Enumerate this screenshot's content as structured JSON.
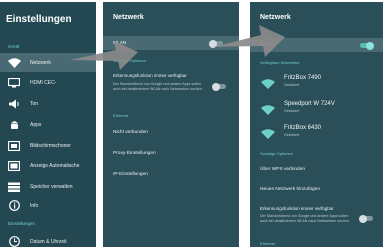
{
  "panel_settings": {
    "title": "Einstellungen",
    "section_device": "Gerät",
    "items": [
      {
        "label": "Netzwerk",
        "icon": "wifi-icon"
      },
      {
        "label": "HDMI CEC-",
        "icon": "hdmi-icon"
      },
      {
        "label": "Ton",
        "icon": "speaker-icon"
      },
      {
        "label": "Apps",
        "icon": "android-icon"
      },
      {
        "label": "Bildschirmschoner",
        "icon": "screensaver-icon"
      },
      {
        "label": "Anzeige Automatische",
        "icon": "display-icon"
      },
      {
        "label": "Speicher verwalten",
        "icon": "storage-icon"
      },
      {
        "label": "Info",
        "icon": "info-icon"
      }
    ],
    "section_settings": "Einstellungen",
    "last_item": {
      "label": "Datum & Uhrzeit",
      "icon": "clock-icon"
    }
  },
  "panel_network": {
    "title": "Netzwerk",
    "wlan_label": "WLAN",
    "section_other": "Sonstige Optionen",
    "scan_title": "Erkennungsfunktion immer verfügbar",
    "scan_desc": "Der Standortdienst von Google und andere Apps sollen auch bei deaktiviertem WLAN nach Netzwerken suchen.",
    "section_ethernet": "Ethernet",
    "eth_status": "Nicht verbunden",
    "proxy": "Proxy-Einstellungen",
    "ip": "IP-Einstellungen"
  },
  "panel_wifi": {
    "title": "Netzwerk",
    "wlan_label": "WLAN",
    "section_available": "Verfügbare Netzwerke",
    "networks": [
      {
        "name": "FritzBox 7490",
        "state": "Gesichert"
      },
      {
        "name": "Speedport W 724V",
        "state": "Gesichert"
      },
      {
        "name": "FritzBox 6430",
        "state": "Gesichert"
      }
    ],
    "section_other": "Sonstige Optionen",
    "wps": "Über WPS verbinden",
    "add_network": "Neues Netzwerk hinzufügen",
    "scan_title": "Erkennungsfunktion immer verfügbar",
    "scan_desc": "Der Standortdienst von Google und andere Apps sollen auch bei deaktiviertem WLAN nach Netzwerken suchen.",
    "section_ethernet": "Ethernet"
  },
  "colors": {
    "panel_bg": "#2b4f59",
    "selected_bg": "#4a6a73",
    "accent": "#6fd0c6",
    "arrow": "#8a8a8a"
  }
}
